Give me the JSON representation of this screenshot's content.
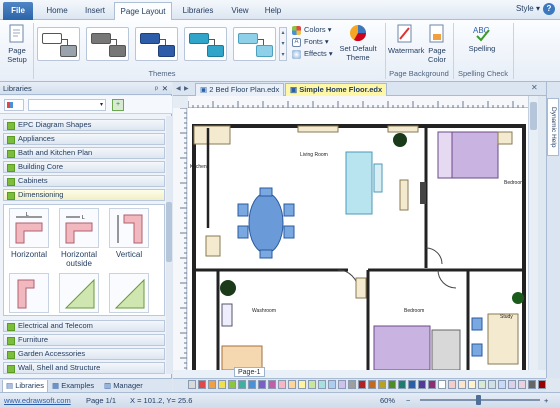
{
  "ribbon_tabs": [
    "File",
    "Home",
    "Insert",
    "Page Layout",
    "Libraries",
    "View",
    "Help"
  ],
  "active_tab": "Page Layout",
  "style_label": "Style",
  "help_label": "?",
  "ribbon": {
    "page_setup": "Page Setup",
    "themes_group": "Themes",
    "colors": "Colors",
    "fonts": "Fonts",
    "effects": "Effects",
    "set_default_theme": "Set Default Theme",
    "page_background_group": "Page Background",
    "watermark": "Watermark",
    "page_color": "Page Color",
    "spelling": "Spelling",
    "spelling_check_group": "Spelling Check"
  },
  "libraries": {
    "title": "Libraries",
    "categories_top": [
      "EPC Diagram Shapes",
      "Appliances",
      "Bath and Kitchen Plan",
      "Building Core",
      "Cabinets",
      "Dimensioning"
    ],
    "open_category": "Dimensioning",
    "shapes": [
      "Horizontal",
      "Horizontal outside",
      "Vertical"
    ],
    "categories_bottom": [
      "Electrical and Telecom",
      "Furniture",
      "Garden Accessories",
      "Wall, Shell and Structure"
    ]
  },
  "panel_tabs": [
    "Libraries",
    "Examples",
    "Manager"
  ],
  "documents": [
    "2 Bed Floor Plan.edx",
    "Simple Home Floor.edx"
  ],
  "active_document": "Simple Home Floor.edx",
  "right_panel": "Dynamic Help",
  "page_tab": "Page-1",
  "rooms": {
    "kitchen": "Kitchen",
    "living": "Living Room",
    "bedroom1": "Bedroom",
    "washroom": "Washroom",
    "bedroom2": "Bedroom",
    "study": "Study"
  },
  "palette_colors": [
    "#d9d9d9",
    "#e04848",
    "#f0a040",
    "#f0e050",
    "#8cc63f",
    "#3fb0a0",
    "#4a90d9",
    "#7b5fc7",
    "#c05fa8",
    "#f7b6c2",
    "#ffd699",
    "#fff3a0",
    "#c8e6a0",
    "#a8dfe0",
    "#aecbf0",
    "#d0c0ee",
    "#9e9e9e",
    "#b22222",
    "#c46a1c",
    "#b8a020",
    "#4f8a22",
    "#1f7a70",
    "#2b5ea8",
    "#533a96",
    "#8a2f72",
    "#ffffff",
    "#f4cccc",
    "#fce5cd",
    "#fff2cc",
    "#d9ead3",
    "#d0e0e3",
    "#c9daf8",
    "#d9d2e9",
    "#ead1dc",
    "#666666",
    "#990000"
  ],
  "status": {
    "website": "www.edrawsoft.com",
    "page": "Page 1/1",
    "coords": "X = 101.2, Y= 25.6",
    "zoom": "60%"
  }
}
